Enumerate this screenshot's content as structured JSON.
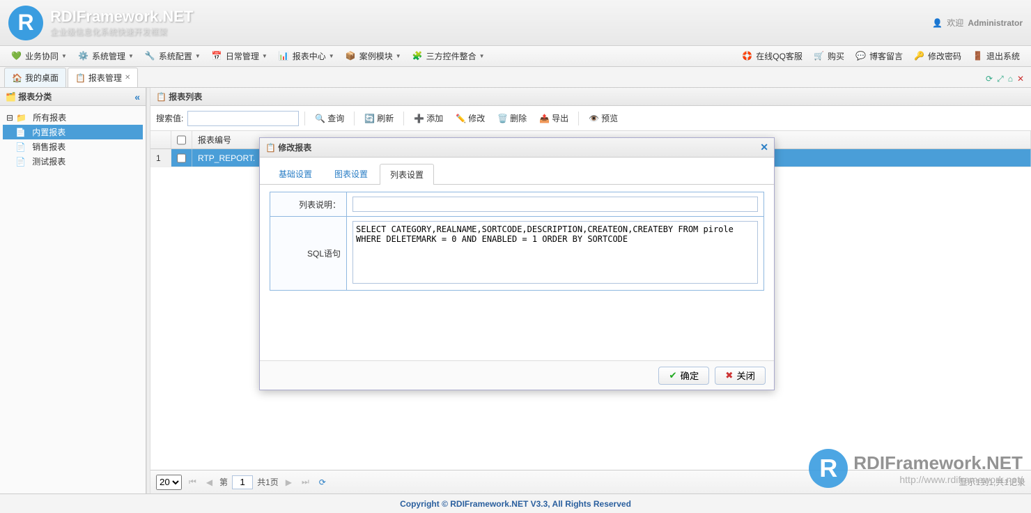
{
  "header": {
    "title": "RDIFramework.NET",
    "subtitle": "企业级信息化系统快速开发框架",
    "welcome": "欢迎",
    "user": "Administrator"
  },
  "menubar": {
    "items": [
      {
        "label": "业务协同"
      },
      {
        "label": "系统管理"
      },
      {
        "label": "系统配置"
      },
      {
        "label": "日常管理"
      },
      {
        "label": "报表中心"
      },
      {
        "label": "案例模块"
      },
      {
        "label": "三方控件整合"
      }
    ],
    "right": [
      {
        "label": "在线QQ客服"
      },
      {
        "label": "购买"
      },
      {
        "label": "博客留言"
      },
      {
        "label": "修改密码"
      },
      {
        "label": "退出系统"
      }
    ]
  },
  "tabs": [
    {
      "label": "我的桌面",
      "closable": false
    },
    {
      "label": "报表管理",
      "closable": true,
      "active": true
    }
  ],
  "sidebar": {
    "title": "报表分类",
    "nodes": {
      "root": "所有报表",
      "children": [
        "内置报表",
        "销售报表",
        "测试报表"
      ]
    },
    "selected": "内置报表"
  },
  "main": {
    "title": "报表列表",
    "search_label": "搜索值:",
    "toolbar": {
      "search": "查询",
      "refresh": "刷新",
      "add": "添加",
      "edit": "修改",
      "delete": "删除",
      "export": "导出",
      "preview": "预览"
    },
    "columns": {
      "id": "报表编号"
    },
    "rows": [
      {
        "num": "1",
        "id": "RTP_REPORT."
      }
    ]
  },
  "pager": {
    "page_size": "20",
    "page_label_prefix": "第",
    "page_current": "1",
    "page_total_text": "共1页",
    "info": "显示1到1,共1记录"
  },
  "dialog": {
    "title": "修改报表",
    "tabs": [
      "基础设置",
      "图表设置",
      "列表设置"
    ],
    "active_tab": "列表设置",
    "fields": {
      "desc_label": "列表说明：",
      "desc_value": "",
      "sql_label": "SQL语句",
      "sql_value": "SELECT CATEGORY,REALNAME,SORTCODE,DESCRIPTION,CREATEON,CREATEBY FROM pirole WHERE DELETEMARK = 0 AND ENABLED = 1 ORDER BY SORTCODE"
    },
    "buttons": {
      "ok": "确定",
      "close": "关闭"
    }
  },
  "footer": "Copyright © RDIFramework.NET V3.3, All Rights Reserved",
  "watermark": {
    "title": "RDIFramework.NET",
    "url": "http://www.rdiframework.net/"
  }
}
